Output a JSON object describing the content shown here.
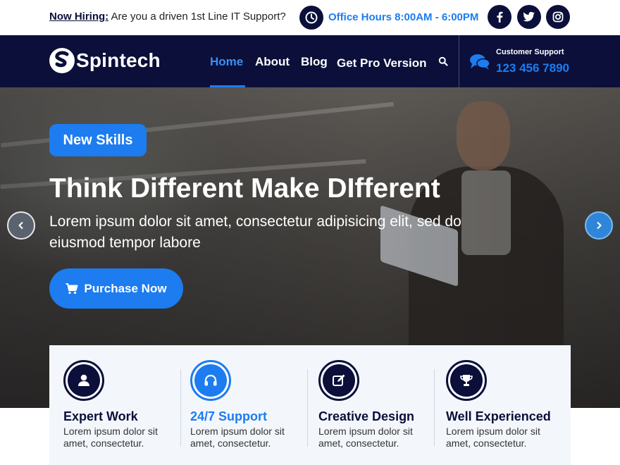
{
  "topbar": {
    "hiring_label": "Now Hiring:",
    "hiring_text": "Are you a driven 1st Line IT Support?",
    "office_hours": "Office Hours 8:00AM - 6:00PM",
    "social": [
      "facebook-icon",
      "twitter-icon",
      "instagram-icon"
    ]
  },
  "nav": {
    "logo": "Spintech",
    "items": [
      "Home",
      "About",
      "Blog",
      "Get Pro Version"
    ],
    "active": "Home",
    "support_label": "Customer Support",
    "support_phone": "123 456 7890"
  },
  "hero": {
    "badge": "New Skills",
    "title": "Think Different Make DIfferent",
    "subtitle": "Lorem ipsum dolor sit amet, consectetur adipisicing elit, sed do eiusmod tempor labore",
    "cta": "Purchase Now"
  },
  "features": [
    {
      "title": "Expert Work",
      "text": "Lorem ipsum dolor sit amet, consectetur.",
      "icon": "user-icon"
    },
    {
      "title": "24/7 Support",
      "text": "Lorem ipsum dolor sit amet, consectetur.",
      "icon": "headphones-icon"
    },
    {
      "title": "Creative Design",
      "text": "Lorem ipsum dolor sit amet, consectetur.",
      "icon": "edit-icon"
    },
    {
      "title": "Well Experienced",
      "text": "Lorem ipsum dolor sit amet, consectetur.",
      "icon": "trophy-icon"
    }
  ],
  "colors": {
    "navy": "#0b0f3a",
    "accent": "#1c7cf0"
  }
}
